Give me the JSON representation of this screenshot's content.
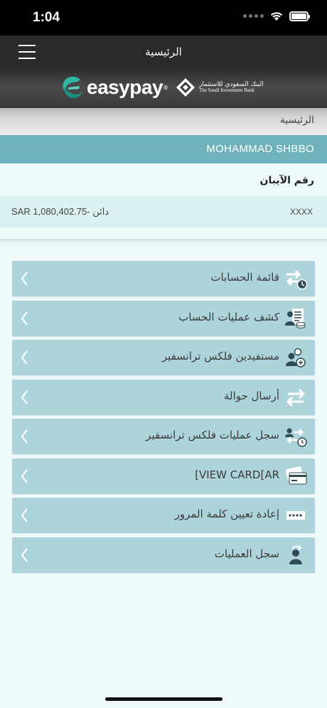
{
  "status_bar": {
    "time": "1:04"
  },
  "nav": {
    "title": "الرئيسية"
  },
  "brand": {
    "name": "easypay",
    "bank_ar": "البنك السعودي للاستثمار",
    "bank_en": "The Saudi Investment Bank"
  },
  "breadcrumb": {
    "text": "الرئيسية"
  },
  "user": {
    "name": "MOHAMMAD SHBBO"
  },
  "account": {
    "iban_label": "رقم الآيبان",
    "balance": "SAR 1,080,402.75- دائن",
    "number": "XXXX"
  },
  "menu": {
    "items": [
      {
        "label": "قائمة الحسابات",
        "icon": "accounts-list-icon"
      },
      {
        "label": "كشف عمليات الحساب",
        "icon": "statement-icon"
      },
      {
        "label": "مستفيدين فلكس ترانسفير",
        "icon": "beneficiaries-icon"
      },
      {
        "label": "أرسال حوالة",
        "icon": "transfer-arrows-icon"
      },
      {
        "label": "سجل عمليات فلكس ترانسفير",
        "icon": "transfer-history-icon"
      },
      {
        "label": "[VIEW CARD[AR",
        "icon": "card-icon"
      },
      {
        "label": "إعادة تعيين كلمة المرور",
        "icon": "password-icon"
      },
      {
        "label": "سجل العمليات",
        "icon": "user-history-icon"
      }
    ]
  },
  "colors": {
    "menu_bg": "#aed4db",
    "user_bar": "#6fb2bc",
    "page_bg": "#eefafa",
    "nav_bg": "#2a2a2a"
  }
}
